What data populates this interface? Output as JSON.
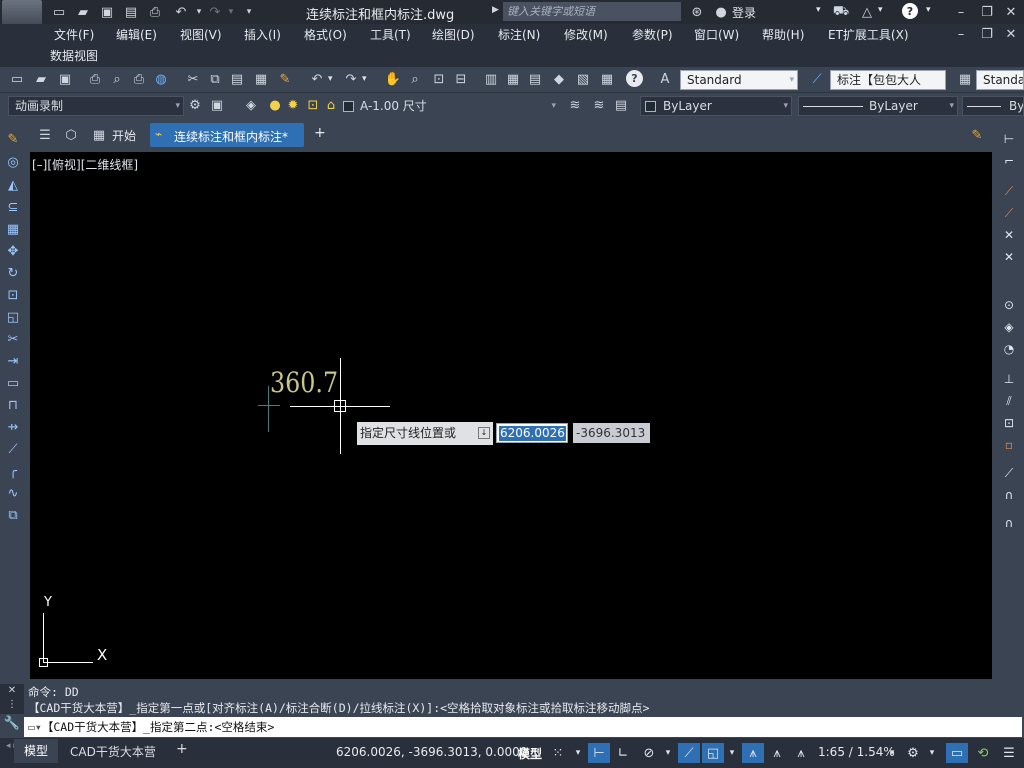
{
  "title_bar": {
    "file_name": "连续标注和框内标注.dwg",
    "search_placeholder": "键入关键字或短语",
    "login": "登录"
  },
  "menu": {
    "items": [
      "文件(F)",
      "编辑(E)",
      "视图(V)",
      "插入(I)",
      "格式(O)",
      "工具(T)",
      "绘图(D)",
      "标注(N)",
      "修改(M)",
      "参数(P)",
      "窗口(W)",
      "帮助(H)",
      "ET扩展工具(X)"
    ],
    "second_row": "数据视图"
  },
  "toolbar1": {
    "text_style": "Standard",
    "dim_style": "标注【包包大人",
    "table_style": "Standard"
  },
  "toolbar2": {
    "workspace": "动画录制",
    "layer": "A-1.00 尺寸",
    "color": "ByLayer",
    "linetype": "ByLayer",
    "lineweight": "By"
  },
  "tabs": {
    "start": "开始",
    "active": "连续标注和框内标注*",
    "add": "+"
  },
  "viewport": {
    "label": "[–][俯视][二维线框]",
    "dim_text": "360.7",
    "prompt": "指定尺寸线位置或",
    "x_value": "6206.0026",
    "y_value": "-3696.3013",
    "ucs_y": "Y",
    "ucs_x": "X"
  },
  "command": {
    "line1": "命令: DD",
    "line2": "【CAD干货大本营】_指定第一点或[对齐标注(A)/标注合断(D)/拉线标注(X)]:<空格拾取对象标注或拾取标注移动脚点>",
    "input": "【CAD干货大本营】_指定第二点:<空格结束>"
  },
  "status": {
    "tab_model": "模型",
    "tab_layout": "CAD干货大本营",
    "coords": "6206.0026, -3696.3013, 0.0000",
    "model_btn": "模型",
    "scale": "1:65 / 1.54%"
  },
  "colors": {
    "canvas": "#000000",
    "accent": "#2f6fb3",
    "dim_text": "#c9c48a",
    "background": "#3b4453"
  }
}
